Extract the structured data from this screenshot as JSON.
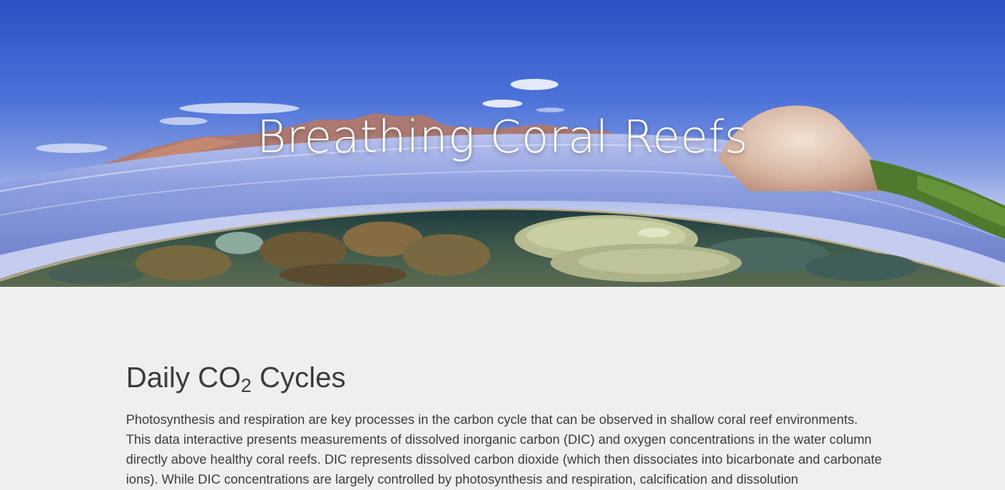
{
  "hero": {
    "title": "Breathing Coral Reefs",
    "icons": [
      "reef-panorama-image"
    ]
  },
  "section": {
    "title_main": "Daily CO",
    "title_sub": "2",
    "title_rest": " Cycles",
    "paragraph": "Photosynthesis and respiration are key processes in the carbon cycle that can be observed in shallow coral reef environments. This data interactive presents measurements of dissolved inorganic carbon (DIC) and oxygen concentrations in the water column directly above healthy coral reefs. DIC represents dissolved carbon dioxide (which then dissociates into bicarbonate and carbonate ions). While DIC concentrations are largely controlled by photosynthesis and respiration, calcification and dissolution"
  },
  "colors": {
    "page_background": "#efefef",
    "text": "#3c3c3c",
    "sky_top": "#2f56c6",
    "title_text": "#ffffff"
  }
}
